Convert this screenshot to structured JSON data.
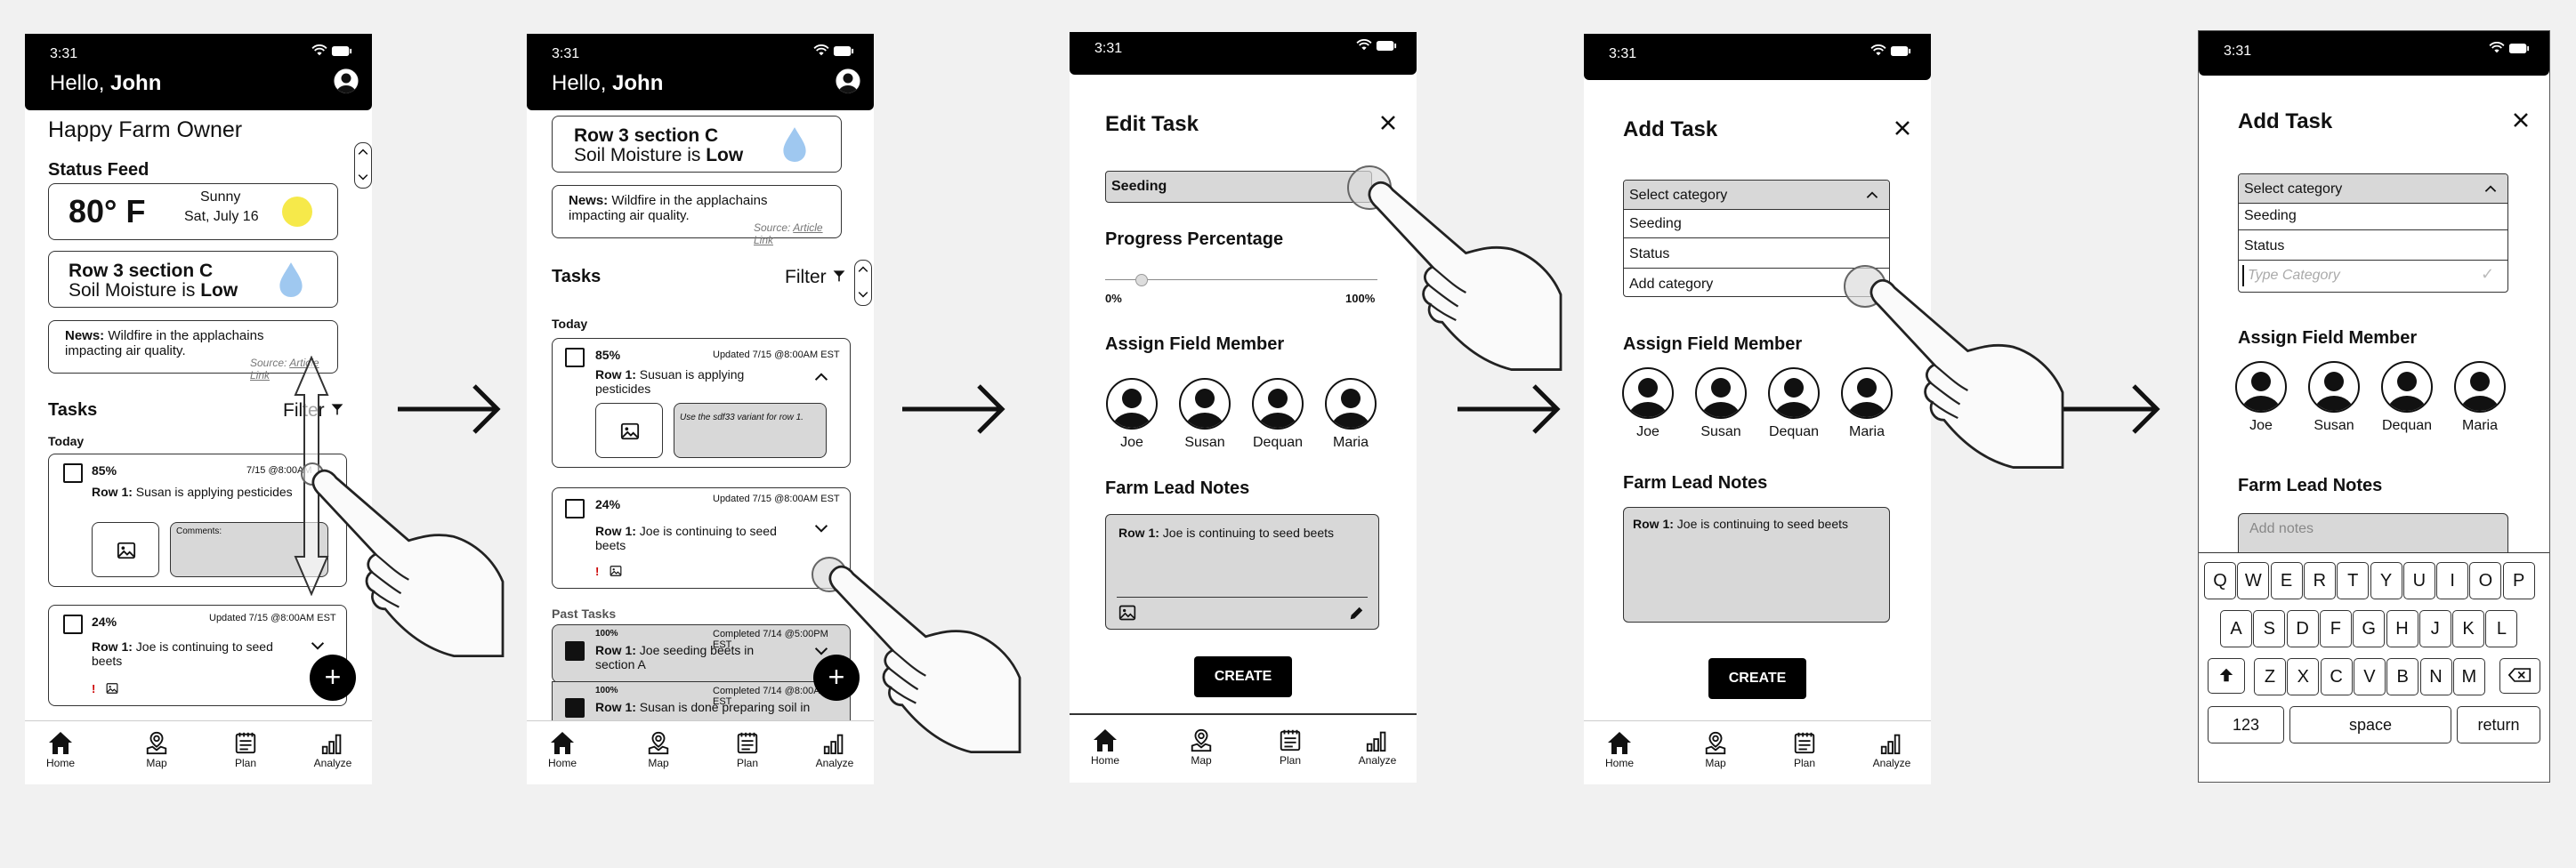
{
  "status_time": "3:31",
  "greeting": {
    "hello": "Hello, ",
    "name": "John"
  },
  "tabs": [
    "Home",
    "Map",
    "Plan",
    "Analyze"
  ],
  "s1": {
    "subtitle": "Happy Farm Owner",
    "status_feed": "Status Feed",
    "weather": {
      "temp": "80° F",
      "cond": "Sunny",
      "date": "Sat, July 16"
    },
    "moisture": {
      "row": "Row 3 section C",
      "pre": "Soil Moisture is ",
      "val": "Low"
    },
    "news": {
      "label": "News:",
      "text": " Wildfire in the applachains impacting air quality.",
      "source_label": "Source: ",
      "source_link": "Article Link"
    },
    "tasks": "Tasks",
    "filter": "Filter",
    "today": "Today",
    "task1": {
      "pct": "85%",
      "updated": "7/15 @8:00AM",
      "row": "Row 1:",
      "text": " Susan is applying pesticides",
      "comments": "Comments:"
    },
    "task2": {
      "pct": "24%",
      "updated": "Updated 7/15 @8:00AM EST",
      "row": "Row 1:",
      "text": " Joe is continuing to seed beets"
    }
  },
  "s2": {
    "task1": {
      "pct": "85%",
      "updated": "Updated 7/15 @8:00AM EST",
      "row": "Row 1:",
      "text": " Susuan is applying pesticides",
      "note": "Use the sdf33 variant for row 1."
    },
    "task2": {
      "pct": "24%",
      "updated": "Updated 7/15 @8:00AM EST",
      "row": "Row 1:",
      "text": " Joe is continuing to seed beets"
    },
    "past": "Past Tasks",
    "past1": {
      "pct": "100%",
      "completed": "Completed 7/14 @5:00PM EST",
      "row": "Row 1:",
      "text": " Joe seeding beets in section A"
    },
    "past2": {
      "pct": "100%",
      "completed": "Completed 7/14 @8:00AM EST",
      "row": "Row 1:",
      "text": " Susan is done preparing soil in"
    }
  },
  "s3": {
    "title": "Edit Task",
    "category": "Seeding",
    "progress_title": "Progress Percentage",
    "progress_min": "0%",
    "progress_max": "100%",
    "progress_value": 0.13,
    "assign": "Assign Field Member",
    "members": [
      "Joe",
      "Susan",
      "Dequan",
      "Maria"
    ],
    "notes_title": "Farm Lead Notes",
    "note_row": "Row 1:",
    "note_text": " Joe is continuing to seed beets",
    "create": "CREATE"
  },
  "s4": {
    "title": "Add Task",
    "select": "Select category",
    "options": [
      "Seeding",
      "Status",
      "Add category"
    ],
    "assign": "Assign Field Member",
    "members": [
      "Joe",
      "Susan",
      "Dequan",
      "Maria"
    ],
    "notes_title": "Farm Lead Notes",
    "note_row": "Row 1:",
    "note_text": " Joe is continuing to seed beets",
    "create": "CREATE"
  },
  "s5": {
    "title": "Add Task",
    "select": "Select category",
    "options": [
      "Seeding",
      "Status"
    ],
    "type_placeholder": "Type Category",
    "assign": "Assign Field Member",
    "members": [
      "Joe",
      "Susan",
      "Dequan",
      "Maria"
    ],
    "notes_title": "Farm Lead Notes",
    "notes_placeholder": "Add notes",
    "keys_row1": [
      "Q",
      "W",
      "E",
      "R",
      "T",
      "Y",
      "U",
      "I",
      "O",
      "P"
    ],
    "keys_row2": [
      "A",
      "S",
      "D",
      "F",
      "G",
      "H",
      "J",
      "K",
      "L"
    ],
    "keys_row3": [
      "Z",
      "X",
      "C",
      "V",
      "B",
      "N",
      "M"
    ],
    "key_123": "123",
    "key_space": "space",
    "key_return": "return"
  }
}
